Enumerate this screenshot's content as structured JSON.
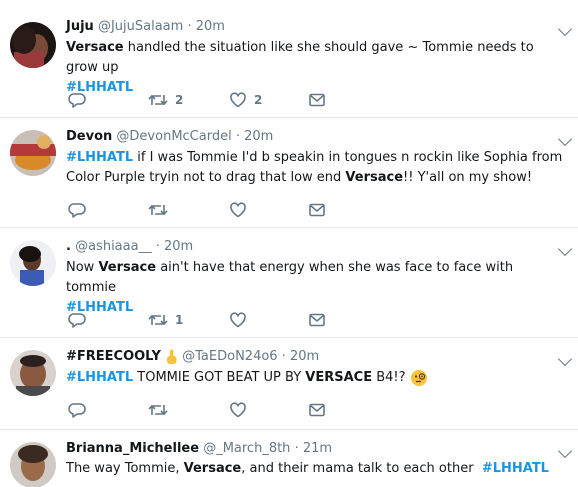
{
  "tweets": [
    {
      "name": "Juju",
      "handle": "@JujuSalaam",
      "dot": "·",
      "time": "20m",
      "line1": {
        "bold1": "Versace",
        "t1": " handled the situation like she should gave ~ Tommie needs to grow up"
      },
      "line2": {
        "tag": "#LHHATL"
      },
      "reply_count": "",
      "retweet_count": "2",
      "like_count": "2"
    },
    {
      "name": "Devon",
      "handle": "@DevonMcCardel",
      "dot": "·",
      "time": "20m",
      "line1": {
        "tag": "#LHHATL",
        "t1": " if I was Tommie I'd b speakin in tongues n rockin like Sophia from"
      },
      "line2": {
        "t1": "Color Purple tryin not to drag that low end ",
        "bold1": "Versace",
        "t2": "!! Y'all on my show!"
      },
      "reply_count": "",
      "retweet_count": "",
      "like_count": ""
    },
    {
      "name": ".",
      "handle": "@ashiaaa__",
      "dot": "·",
      "time": "20m",
      "line1": {
        "t1": "Now ",
        "bold1": "Versace",
        "t2": " ain't have that energy when she was face to face with tommie"
      },
      "line2": {
        "tag": "#LHHATL"
      },
      "reply_count": "",
      "retweet_count": "1",
      "like_count": ""
    },
    {
      "name": "#FREECOOLY",
      "name_emoji": "point-up-emoji",
      "handle": "@TaEDoN24o6",
      "dot": "·",
      "time": "20m",
      "line1": {
        "tag": "#LHHATL",
        "t1": " TOMMIE GOT BEAT UP BY ",
        "bold1": "VERSACE",
        "t2": " B4!?",
        "emoji": "face-with-monocle-emoji"
      },
      "reply_count": "",
      "retweet_count": "",
      "like_count": ""
    },
    {
      "name": "Brianna_Michellee",
      "handle": "@_March_8th",
      "dot": "·",
      "time": "21m",
      "line1": {
        "t1": "The way Tommie, ",
        "bold1": "Versace",
        "t2": ", and their mama talk to each other  ",
        "tag": "#LHHATL"
      }
    }
  ],
  "colors": {
    "hashtag": "#1b95e0",
    "meta": "#657786",
    "divider": "#e6ecf0"
  },
  "icons": [
    "reply-icon",
    "retweet-icon",
    "like-icon",
    "dm-icon",
    "chevron-down-icon"
  ]
}
